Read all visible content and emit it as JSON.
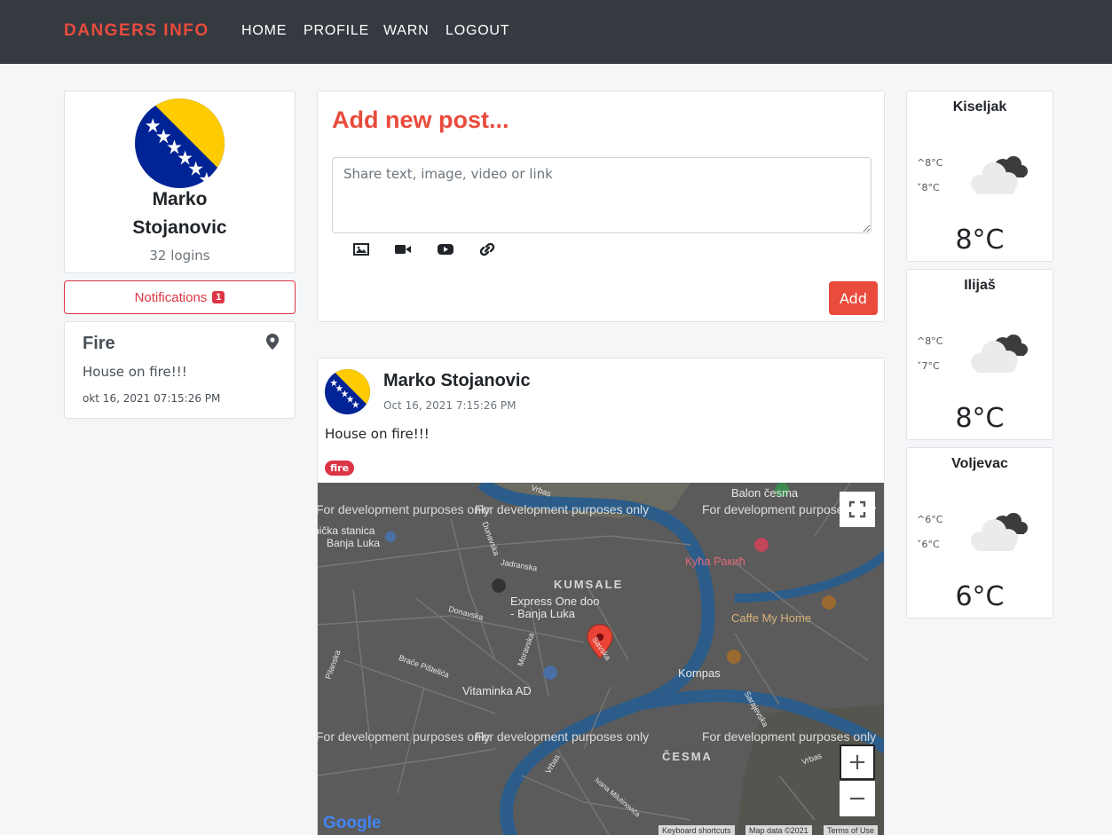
{
  "nav": {
    "brand": "DANGERS INFO",
    "links": [
      "HOME",
      "PROFILE",
      "WARN",
      "LOGOUT"
    ]
  },
  "profile": {
    "name": "Marko Stojanovic",
    "logins": "32 logins",
    "avatar_icon": "bosnia-flag-avatar"
  },
  "notifications": {
    "label": "Notifications",
    "count": "1"
  },
  "alert": {
    "title": "Fire",
    "text": "House on fire!!!",
    "date": "okt 16, 2021 07:15:26 PM",
    "icon": "map-marker-icon"
  },
  "new_post": {
    "title": "Add new post...",
    "placeholder": "Share text, image, video or link",
    "tools": [
      "image-icon",
      "video-icon",
      "youtube-icon",
      "link-icon"
    ],
    "add_label": "Add"
  },
  "post": {
    "author": "Marko Stojanovic",
    "date": "Oct 16, 2021 7:15:26 PM",
    "text": "House on fire!!!",
    "tag": "fire",
    "map": {
      "dev_text": "For development purposes only",
      "places": {
        "balon": "Balon česma",
        "stanica_1": "nička stanica",
        "stanica_2": "Banja Luka",
        "kuca": "Кућа Ракић",
        "kumsale": "KUMSALE",
        "express_1": "Express One doo",
        "express_2": "- Banja Luka",
        "caffe": "Caffe My Home",
        "kompas": "Kompas",
        "vitaminka": "Vitaminka AD",
        "cesma": "ČESMA"
      },
      "streets": {
        "vrbas_top": "Vrbas",
        "dunavska": "Dunavska",
        "jadranska": "Jadranska",
        "donavska": "Donavska",
        "moravska": "Moravska",
        "savska": "Savska",
        "pilanska": "Pilanska",
        "braca": "Braće Pištelića",
        "sarajevska": "Sarajevska",
        "vrbas_bottom": "Vrbas",
        "vrbas_right": "Vrbas",
        "ivana": "Ivana Milutinovića"
      },
      "keyboard": "Keyboard shortcuts",
      "mapdata": "Map data ©2021",
      "terms": "Terms of Use",
      "zoom_in": "+",
      "zoom_out": "−",
      "logo": "Google"
    }
  },
  "weather": [
    {
      "city": "Kiseljak",
      "hi": "^8°C",
      "lo": "˅8°C",
      "temp": "8°C",
      "icon": "cloudy-icon"
    },
    {
      "city": "Ilijaš",
      "hi": "^8°C",
      "lo": "˅7°C",
      "temp": "8°C",
      "icon": "cloudy-icon"
    },
    {
      "city": "Voljevac",
      "hi": "^6°C",
      "lo": "˅6°C",
      "temp": "6°C",
      "icon": "cloudy-icon"
    }
  ]
}
